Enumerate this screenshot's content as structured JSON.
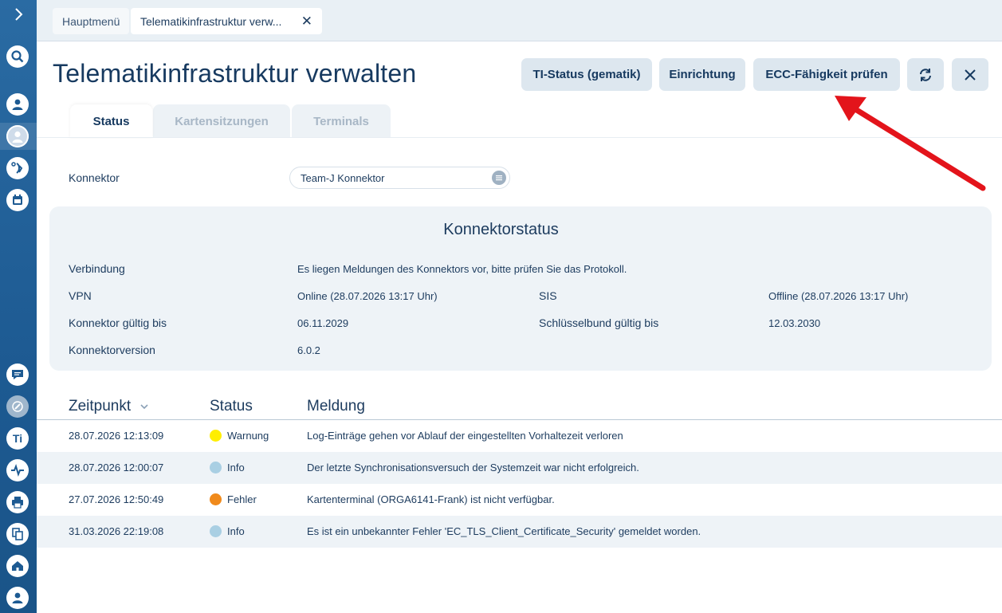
{
  "tabs": {
    "home_label": "Hauptmenü",
    "current_label": "Telematikinfrastruktur verw...",
    "close_glyph": "✕"
  },
  "page": {
    "title": "Telematikinfrastruktur verwalten"
  },
  "actions": {
    "ti_status": "TI-Status (gematik)",
    "setup": "Einrichtung",
    "ecc_check": "ECC-Fähigkeit prüfen"
  },
  "subtabs": {
    "status": "Status",
    "card_sessions": "Kartensitzungen",
    "terminals": "Terminals"
  },
  "connector": {
    "label": "Konnektor",
    "value": "Team-J Konnektor"
  },
  "connector_status": {
    "title": "Konnektorstatus",
    "connection_label": "Verbindung",
    "connection_value": "Es liegen Meldungen des Konnektors vor, bitte prüfen Sie das Protokoll.",
    "vpn_label": "VPN",
    "vpn_value": "Online (28.07.2026 13:17 Uhr)",
    "sis_label": "SIS",
    "sis_value": "Offline (28.07.2026 13:17 Uhr)",
    "valid_label": "Konnektor gültig bis",
    "valid_value": "06.11.2029",
    "keyring_label": "Schlüsselbund gültig bis",
    "keyring_value": "12.03.2030",
    "version_label": "Konnektorversion",
    "version_value": "6.0.2"
  },
  "log": {
    "col_time": "Zeitpunkt",
    "col_status": "Status",
    "col_message": "Meldung",
    "rows": [
      {
        "time": "28.07.2026 12:13:09",
        "status": "Warnung",
        "message": "Log-Einträge gehen vor Ablauf der eingestellten Vorhaltezeit verloren"
      },
      {
        "time": "28.07.2026 12:00:07",
        "status": "Info",
        "message": "Der letzte Synchronisationsversuch der Systemzeit war nicht erfolgreich."
      },
      {
        "time": "27.07.2026 12:50:49",
        "status": "Fehler",
        "message": "Kartenterminal (ORGA6141-Frank) ist nicht verfügbar."
      },
      {
        "time": "31.03.2026 22:19:08",
        "status": "Info",
        "message": "Es ist ein unbekannter Fehler 'EC_TLS_Client_Certificate_Security' gemeldet worden."
      }
    ]
  },
  "colors": {
    "warning": "#ffee00",
    "info": "#a9cfe3",
    "error": "#f08a1c",
    "annotation_arrow": "#e3141b"
  },
  "sidebar": {
    "ti_glyph": "Ti"
  }
}
